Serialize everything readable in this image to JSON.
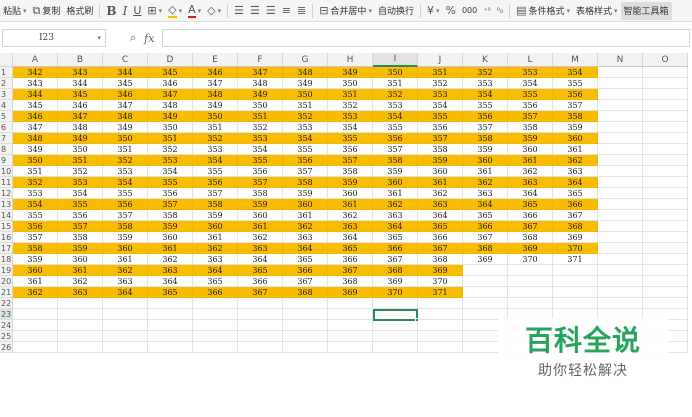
{
  "toolbar": {
    "paste_label": "粘贴",
    "copy_label": "复制",
    "format_painter_label": "格式刷",
    "merge_center_label": "合并居中",
    "auto_wrap_label": "自动换行",
    "percent_label": "%",
    "thousands_label": "000",
    "conditional_format_label": "条件格式",
    "table_style_label": "表格样式",
    "smart_toolbox_label": "智能工具箱"
  },
  "formula_bar": {
    "cell_ref": "I23",
    "fx_label": "fx",
    "content": ""
  },
  "columns": [
    "A",
    "B",
    "C",
    "D",
    "E",
    "F",
    "G",
    "H",
    "I",
    "J",
    "K",
    "L",
    "M",
    "N",
    "O"
  ],
  "selected_column": "I",
  "selected_row": 23,
  "active_cell": "I23",
  "row_numbers": [
    "1",
    "2",
    "3",
    "4",
    "5",
    "6",
    "7",
    "8",
    "9",
    "10",
    "11",
    "12",
    "13",
    "14",
    "15",
    "16",
    "17",
    "18",
    "19",
    "20",
    "21",
    "22",
    "23",
    "24",
    "25",
    "26"
  ],
  "highlight_color": "#f8bc00",
  "accent_color": "#2b8b56",
  "rows": [
    {
      "hl": true,
      "values": [
        "342",
        "343",
        "344",
        "345",
        "346",
        "347",
        "348",
        "349",
        "350",
        "351",
        "352",
        "353",
        "354"
      ]
    },
    {
      "hl": false,
      "values": [
        "343",
        "344",
        "345",
        "346",
        "347",
        "348",
        "349",
        "350",
        "351",
        "352",
        "353",
        "354",
        "355"
      ]
    },
    {
      "hl": true,
      "values": [
        "344",
        "345",
        "346",
        "347",
        "348",
        "349",
        "350",
        "351",
        "352",
        "353",
        "354",
        "355",
        "356"
      ]
    },
    {
      "hl": false,
      "values": [
        "345",
        "346",
        "347",
        "348",
        "349",
        "350",
        "351",
        "352",
        "353",
        "354",
        "355",
        "356",
        "357"
      ]
    },
    {
      "hl": true,
      "values": [
        "346",
        "347",
        "348",
        "349",
        "350",
        "351",
        "352",
        "353",
        "354",
        "355",
        "356",
        "357",
        "358"
      ]
    },
    {
      "hl": false,
      "values": [
        "347",
        "348",
        "349",
        "350",
        "351",
        "352",
        "353",
        "354",
        "355",
        "356",
        "357",
        "358",
        "359"
      ]
    },
    {
      "hl": true,
      "values": [
        "348",
        "349",
        "350",
        "351",
        "352",
        "353",
        "354",
        "355",
        "356",
        "357",
        "358",
        "359",
        "360"
      ]
    },
    {
      "hl": false,
      "values": [
        "349",
        "350",
        "351",
        "352",
        "353",
        "354",
        "355",
        "356",
        "357",
        "358",
        "359",
        "360",
        "361"
      ]
    },
    {
      "hl": true,
      "values": [
        "350",
        "351",
        "352",
        "353",
        "354",
        "355",
        "356",
        "357",
        "358",
        "359",
        "360",
        "361",
        "362"
      ]
    },
    {
      "hl": false,
      "values": [
        "351",
        "352",
        "353",
        "354",
        "355",
        "356",
        "357",
        "358",
        "359",
        "360",
        "361",
        "362",
        "363"
      ]
    },
    {
      "hl": true,
      "values": [
        "352",
        "353",
        "354",
        "355",
        "356",
        "357",
        "358",
        "359",
        "360",
        "361",
        "362",
        "363",
        "364"
      ]
    },
    {
      "hl": false,
      "values": [
        "353",
        "354",
        "355",
        "356",
        "357",
        "358",
        "359",
        "360",
        "361",
        "362",
        "363",
        "364",
        "365"
      ]
    },
    {
      "hl": true,
      "values": [
        "354",
        "355",
        "356",
        "357",
        "358",
        "359",
        "360",
        "361",
        "362",
        "363",
        "364",
        "365",
        "366"
      ]
    },
    {
      "hl": false,
      "values": [
        "355",
        "356",
        "357",
        "358",
        "359",
        "360",
        "361",
        "362",
        "363",
        "364",
        "365",
        "366",
        "367"
      ]
    },
    {
      "hl": true,
      "values": [
        "356",
        "357",
        "358",
        "359",
        "360",
        "361",
        "362",
        "363",
        "364",
        "365",
        "366",
        "367",
        "368"
      ]
    },
    {
      "hl": false,
      "values": [
        "357",
        "358",
        "359",
        "360",
        "361",
        "362",
        "363",
        "364",
        "365",
        "366",
        "367",
        "368",
        "369"
      ]
    },
    {
      "hl": true,
      "values": [
        "358",
        "359",
        "360",
        "361",
        "362",
        "363",
        "364",
        "365",
        "366",
        "367",
        "368",
        "369",
        "370"
      ]
    },
    {
      "hl": false,
      "values": [
        "359",
        "360",
        "361",
        "362",
        "363",
        "364",
        "365",
        "366",
        "367",
        "368",
        "369",
        "370",
        "371"
      ]
    },
    {
      "hl": true,
      "values": [
        "360",
        "361",
        "362",
        "363",
        "364",
        "365",
        "366",
        "367",
        "368",
        "369",
        "",
        "",
        ""
      ]
    },
    {
      "hl": false,
      "values": [
        "361",
        "362",
        "363",
        "364",
        "365",
        "366",
        "367",
        "368",
        "369",
        "370",
        "",
        "",
        ""
      ]
    },
    {
      "hl": true,
      "values": [
        "362",
        "363",
        "364",
        "365",
        "366",
        "367",
        "368",
        "369",
        "370",
        "371",
        "",
        "",
        ""
      ]
    }
  ],
  "watermark": {
    "title": "百科全说",
    "subtitle": "助你轻松解决"
  }
}
